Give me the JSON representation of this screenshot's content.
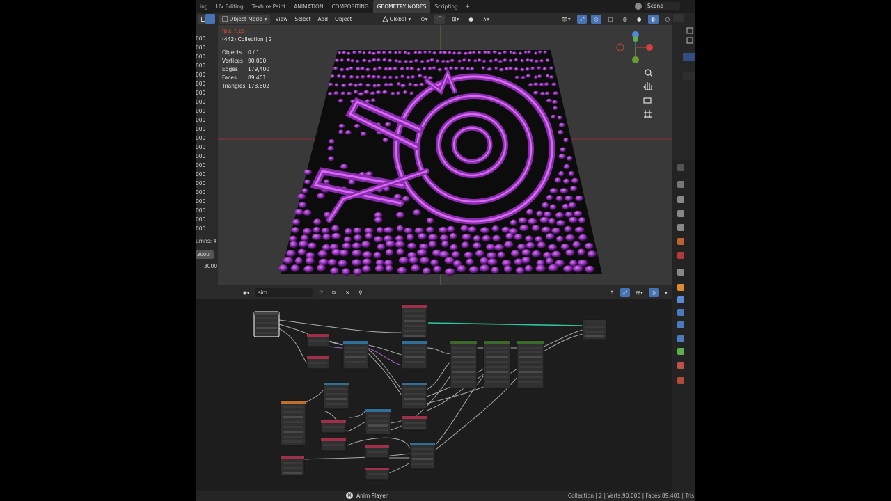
{
  "workspace_tabs": [
    "ing",
    "UV Editing",
    "Texture Paint",
    "ANIMATION",
    "COMPOSITING",
    "GEOMETRY NODES",
    "Scripting"
  ],
  "active_tab_index": 5,
  "tab_plus": "+",
  "scene": "Scene",
  "viewport_header": {
    "mode": "Object Mode",
    "menus": [
      "View",
      "Select",
      "Add",
      "Object"
    ],
    "transform": "Global"
  },
  "left_panel": {
    "values": [
      "000",
      "000",
      "000",
      "000",
      "000",
      "000",
      "000",
      "000",
      "000",
      "000",
      "000",
      "000",
      "000",
      "000",
      "000",
      "000",
      "000",
      "000",
      "000",
      "000",
      "000",
      "000",
      "000"
    ],
    "columns_label": "umns: 4",
    "field_value": "3000",
    "field_value2": "3000"
  },
  "viewport_overlay": {
    "fps": "fps: 7.15",
    "collection": "(442) Collection | 2",
    "stats": [
      {
        "label": "Objects",
        "value": "0 / 1"
      },
      {
        "label": "Vertices",
        "value": "90,000"
      },
      {
        "label": "Edges",
        "value": "179,400"
      },
      {
        "label": "Faces",
        "value": "89,401"
      },
      {
        "label": "Triangles",
        "value": "178,802"
      }
    ]
  },
  "node_editor": {
    "tree_name": "sim"
  },
  "status_bar": {
    "anim_player": "Anim Player",
    "info": "Collection | 2 | Verts:90,000 | Faces:89,401 | Tris"
  },
  "colors": {
    "accent_blue": "#4772b3",
    "pattern_purple": "#8a2db0",
    "pattern_highlight": "#d86af0",
    "node_link_green": "#2fc5a0",
    "axis_red": "#b23a3a",
    "axis_green": "#6a9a2f"
  }
}
